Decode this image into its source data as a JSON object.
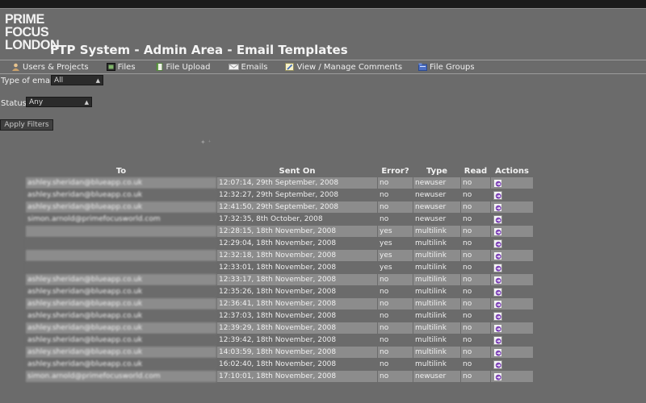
{
  "logo": {
    "line1": "PRIME",
    "line2": "FOCUS",
    "line3": "LONDON"
  },
  "page": {
    "title": "FTP System - Admin Area - Email Templates"
  },
  "nav": [
    {
      "label": "Users & Projects",
      "icon": "user-icon"
    },
    {
      "label": "Files",
      "icon": "film-icon"
    },
    {
      "label": "File Upload",
      "icon": "document-icon"
    },
    {
      "label": "Emails",
      "icon": "envelope-icon"
    },
    {
      "label": "View / Manage Comments",
      "icon": "pencil-icon"
    },
    {
      "label": "File Groups",
      "icon": "folder-icon"
    }
  ],
  "filters": {
    "type_label": "Type of email",
    "type_value": "All",
    "status_label": "Status:",
    "status_value": "Any",
    "apply_label": "Apply Filters"
  },
  "table": {
    "headers": {
      "to": "To",
      "sent": "Sent On",
      "error": "Error?",
      "type": "Type",
      "read": "Read",
      "actions": "Actions"
    },
    "rows": [
      {
        "to": "ashley.sheridan@blueapp.co.uk",
        "sent": "12:07:14, 29th September, 2008",
        "error": "no",
        "type": "newuser",
        "read": "no"
      },
      {
        "to": "ashley.sheridan@blueapp.co.uk",
        "sent": "12:32:27, 29th September, 2008",
        "error": "no",
        "type": "newuser",
        "read": "no"
      },
      {
        "to": "ashley.sheridan@blueapp.co.uk",
        "sent": "12:41:50, 29th September, 2008",
        "error": "no",
        "type": "newuser",
        "read": "no"
      },
      {
        "to": "simon.arnold@primefocusworld.com",
        "sent": "17:32:35, 8th October, 2008",
        "error": "no",
        "type": "newuser",
        "read": "no"
      },
      {
        "to": "",
        "sent": "12:28:15, 18th November, 2008",
        "error": "yes",
        "type": "multilink",
        "read": "no"
      },
      {
        "to": "",
        "sent": "12:29:04, 18th November, 2008",
        "error": "yes",
        "type": "multilink",
        "read": "no"
      },
      {
        "to": "",
        "sent": "12:32:18, 18th November, 2008",
        "error": "yes",
        "type": "multilink",
        "read": "no"
      },
      {
        "to": "",
        "sent": "12:33:01, 18th November, 2008",
        "error": "yes",
        "type": "multilink",
        "read": "no"
      },
      {
        "to": "ashley.sheridan@blueapp.co.uk",
        "sent": "12:33:17, 18th November, 2008",
        "error": "no",
        "type": "multilink",
        "read": "no"
      },
      {
        "to": "ashley.sheridan@blueapp.co.uk",
        "sent": "12:35:26, 18th November, 2008",
        "error": "no",
        "type": "multilink",
        "read": "no"
      },
      {
        "to": "ashley.sheridan@blueapp.co.uk",
        "sent": "12:36:41, 18th November, 2008",
        "error": "no",
        "type": "multilink",
        "read": "no"
      },
      {
        "to": "ashley.sheridan@blueapp.co.uk",
        "sent": "12:37:03, 18th November, 2008",
        "error": "no",
        "type": "multilink",
        "read": "no"
      },
      {
        "to": "ashley.sheridan@blueapp.co.uk",
        "sent": "12:39:29, 18th November, 2008",
        "error": "no",
        "type": "multilink",
        "read": "no"
      },
      {
        "to": "ashley.sheridan@blueapp.co.uk",
        "sent": "12:39:42, 18th November, 2008",
        "error": "no",
        "type": "multilink",
        "read": "no"
      },
      {
        "to": "ashley.sheridan@blueapp.co.uk",
        "sent": "14:03:59, 18th November, 2008",
        "error": "no",
        "type": "multilink",
        "read": "no"
      },
      {
        "to": "ashley.sheridan@blueapp.co.uk",
        "sent": "16:02:40, 18th November, 2008",
        "error": "no",
        "type": "multilink",
        "read": "no"
      },
      {
        "to": "simon.arnold@primefocusworld.com",
        "sent": "17:10:01, 18th November, 2008",
        "error": "no",
        "type": "newuser",
        "read": "no"
      }
    ]
  },
  "colors": {
    "page_bg": "#6b6b6b",
    "row_alt": "#8c8c8c",
    "topbar": "#1b1b1b",
    "action_icon": "#7b3fb5"
  }
}
